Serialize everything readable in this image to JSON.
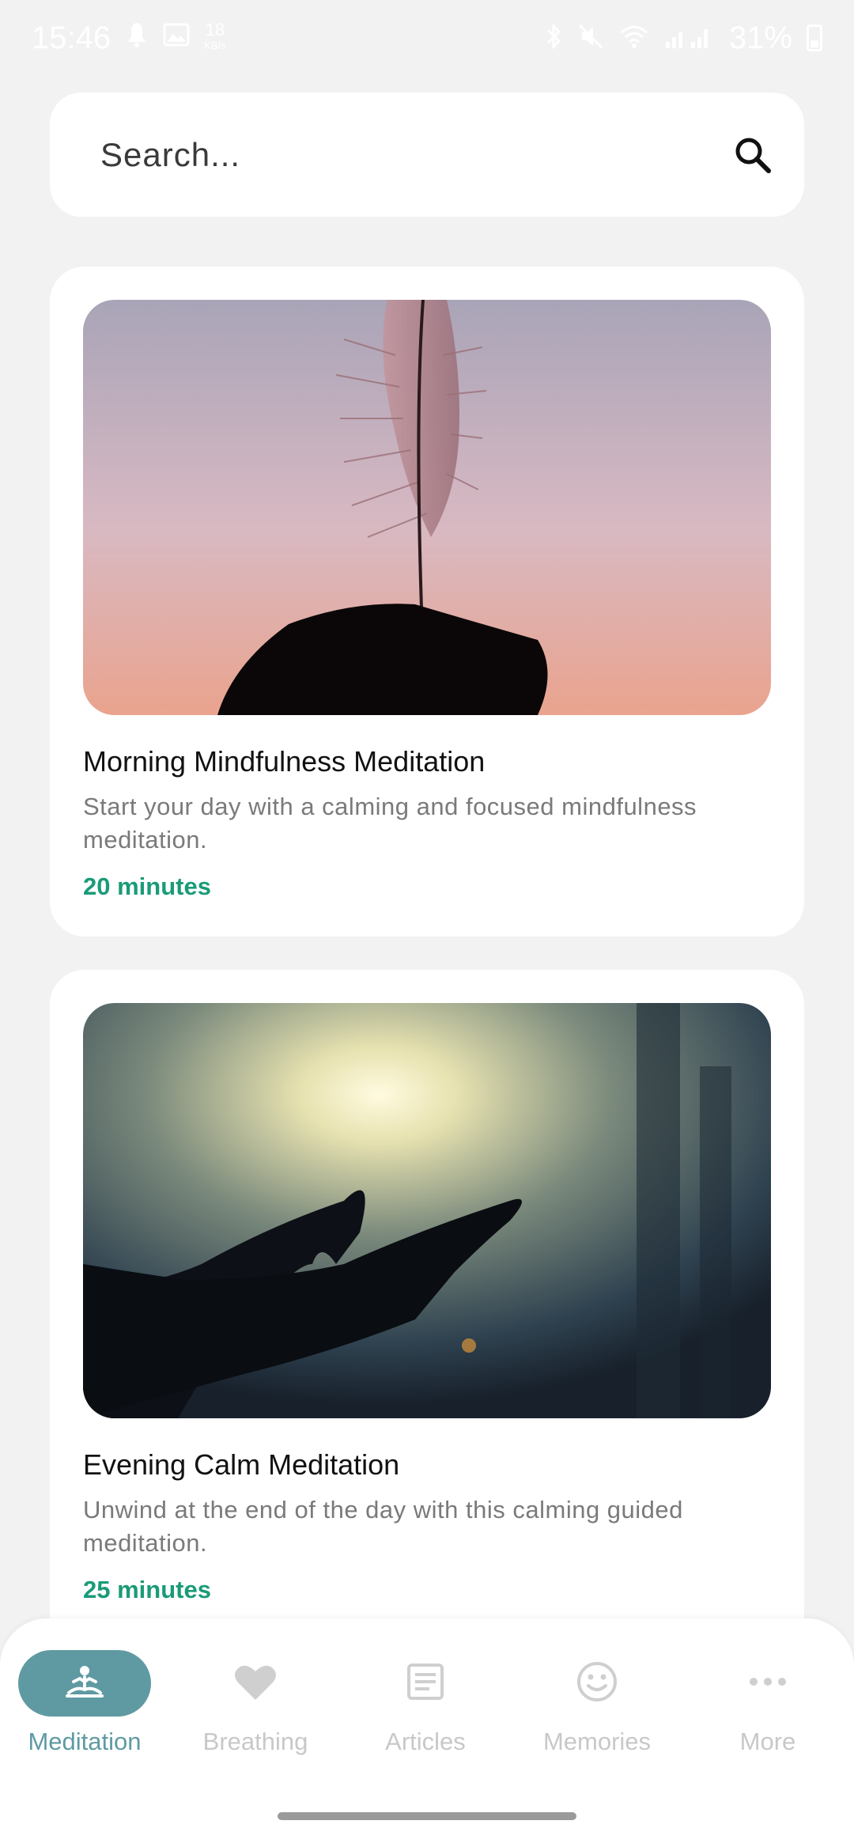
{
  "status_bar": {
    "time": "15:46",
    "speed_value": "18",
    "speed_unit": "KB/s",
    "battery": "31%"
  },
  "search": {
    "placeholder": "Search...",
    "icon": "search-icon"
  },
  "cards": [
    {
      "title": "Morning Mindfulness Meditation",
      "description": "Start your day with a calming and focused mindfulness meditation.",
      "duration": "20 minutes",
      "image": "feather-silhouette-sunset"
    },
    {
      "title": "Evening Calm Meditation",
      "description": "Unwind at the end of the day with this calming guided meditation.",
      "duration": "25 minutes",
      "image": "hands-reaching-forest-sunlight"
    }
  ],
  "nav": {
    "items": [
      {
        "label": "Meditation",
        "icon": "meditation-icon",
        "active": true
      },
      {
        "label": "Breathing",
        "icon": "heart-icon",
        "active": false
      },
      {
        "label": "Articles",
        "icon": "article-icon",
        "active": false
      },
      {
        "label": "Memories",
        "icon": "smiley-icon",
        "active": false
      },
      {
        "label": "More",
        "icon": "more-icon",
        "active": false
      }
    ]
  },
  "colors": {
    "accent": "#5f9aa2",
    "duration": "#1a9b78",
    "background": "#f2f2f2"
  }
}
